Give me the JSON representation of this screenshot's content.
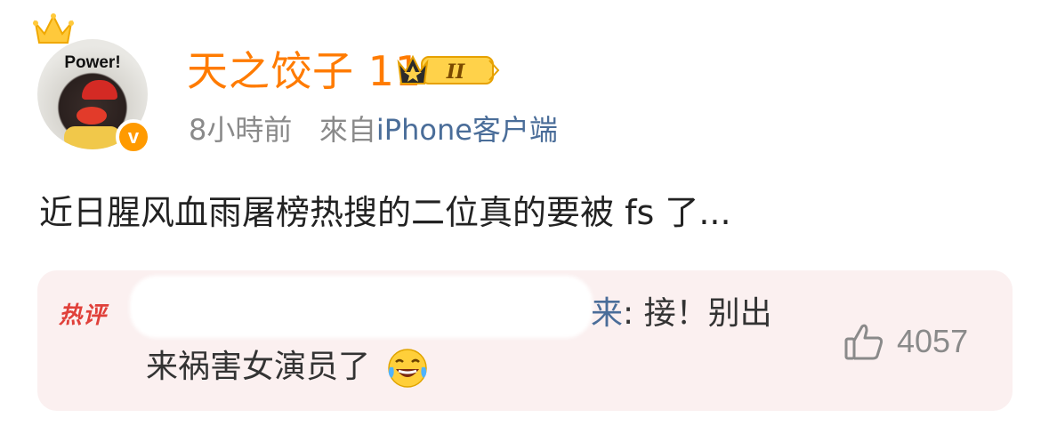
{
  "author": {
    "username": "天之饺子 11",
    "avatar_text": "Power!",
    "verified_mark": "v",
    "level_badge": "II",
    "icons": [
      "crown-icon",
      "level-badge-icon",
      "verified-icon"
    ],
    "colors": {
      "username": "#ff7b00",
      "verified": "#ff9a00"
    }
  },
  "meta": {
    "time": "8小時前",
    "from_label": "來自",
    "source": "iPhone客户端"
  },
  "post": {
    "text": "近日腥风血雨屠榜热搜的二位真的要被 fs 了..."
  },
  "hot_comment": {
    "tag": "热评",
    "line1_name_tail": "来",
    "line1_text": ": 接！别出",
    "line2_text": "来祸害女演员了",
    "emoji": "laughing-tears-emoji",
    "like_icon": "thumbs-up-icon",
    "likes": "4057",
    "colors": {
      "tag": "#e0403a",
      "background": "#fbf0f0"
    }
  }
}
